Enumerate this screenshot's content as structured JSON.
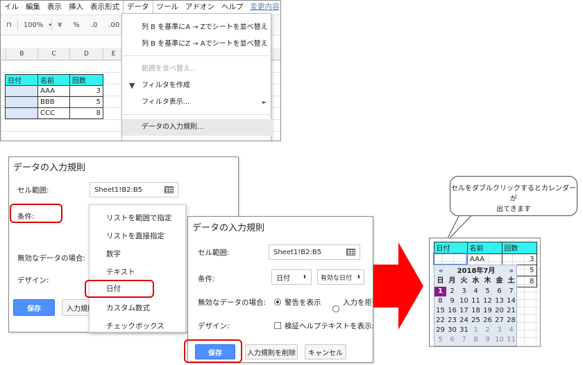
{
  "menubar": {
    "items": [
      "イル",
      "編集",
      "表示",
      "挿入",
      "表示形式",
      "データ",
      "ツール",
      "アドオン",
      "ヘルプ"
    ],
    "link": "変更内容"
  },
  "toolbar": {
    "zoom": "100%",
    "currency": "¥",
    "percent": "%",
    "dec_less": ".0",
    "dec_more": ".00"
  },
  "sheet": {
    "columns": [
      "B",
      "C",
      "D",
      "E"
    ],
    "headers": [
      "日付",
      "名前",
      "回数"
    ],
    "rows": [
      {
        "date": "",
        "name": "AAA",
        "count": "3"
      },
      {
        "date": "",
        "name": "BBB",
        "count": "5"
      },
      {
        "date": "",
        "name": "CCC",
        "count": "8"
      }
    ]
  },
  "data_menu": {
    "sort_az": "列 B を基準にA → Zでシートを並べ替え",
    "sort_za": "列 B を基準にZ → Aでシートを並べ替え",
    "sort_range": "範囲を並べ替え...",
    "create_filter": "フィルタを作成",
    "filter_views": "フィルタ表示...",
    "data_validation": "データの入力規則...",
    "arrow": "►"
  },
  "dialog1": {
    "title": "データの入力規則",
    "range_label": "セル範囲:",
    "range_value": "Sheet1!B2:B5",
    "criteria_label": "条件:",
    "invalid_label": "無効なデータの場合:",
    "design_label": "デザイン:",
    "save": "保存",
    "remove": "入力規則"
  },
  "criteria_dropdown": {
    "options": [
      "リストを範囲で指定",
      "リストを直接指定",
      "数字",
      "テキスト",
      "日付",
      "カスタム数式",
      "チェックボックス"
    ]
  },
  "dialog2": {
    "title": "データの入力規則",
    "range_label": "セル範囲:",
    "range_value": "Sheet1!B2:B5",
    "criteria_label": "条件:",
    "criteria_type": "日付",
    "criteria_condition": "有効な日付",
    "invalid_label": "無効なデータの場合:",
    "show_warning": "警告を表示",
    "reject_input": "入力を拒否",
    "design_label": "デザイン:",
    "help_text": "検証ヘルプテキストを表示:",
    "save": "保存",
    "remove": "入力規則を削除",
    "cancel": "キャンセル"
  },
  "bubble": {
    "text1": "セルをダブルクリックするとカレンダーが",
    "text2": "出てきます"
  },
  "calendar_sheet": {
    "headers": [
      "日付",
      "名前",
      "回数"
    ],
    "name1": "AAA",
    "counts": [
      "3",
      "5",
      "8"
    ]
  },
  "calendar": {
    "prev": "«",
    "month": "2018年7月",
    "next": "»",
    "weekdays": [
      "日",
      "月",
      "火",
      "水",
      "木",
      "金",
      "土"
    ],
    "weeks": [
      [
        "1",
        "2",
        "3",
        "4",
        "5",
        "6",
        "7"
      ],
      [
        "8",
        "9",
        "10",
        "11",
        "12",
        "13",
        "14"
      ],
      [
        "15",
        "16",
        "17",
        "18",
        "19",
        "20",
        "21"
      ],
      [
        "22",
        "23",
        "24",
        "25",
        "26",
        "27",
        "28"
      ],
      [
        "29",
        "30",
        "31",
        "1",
        "2",
        "3",
        "4"
      ],
      [
        "5",
        "6",
        "7",
        "8",
        "9",
        "10",
        "11"
      ]
    ]
  },
  "colors": {
    "header_cyan": "#33f2f2",
    "save_blue": "#4d90fe",
    "callout_red": "#ff0000",
    "today_purple": "#8b1a8f"
  }
}
